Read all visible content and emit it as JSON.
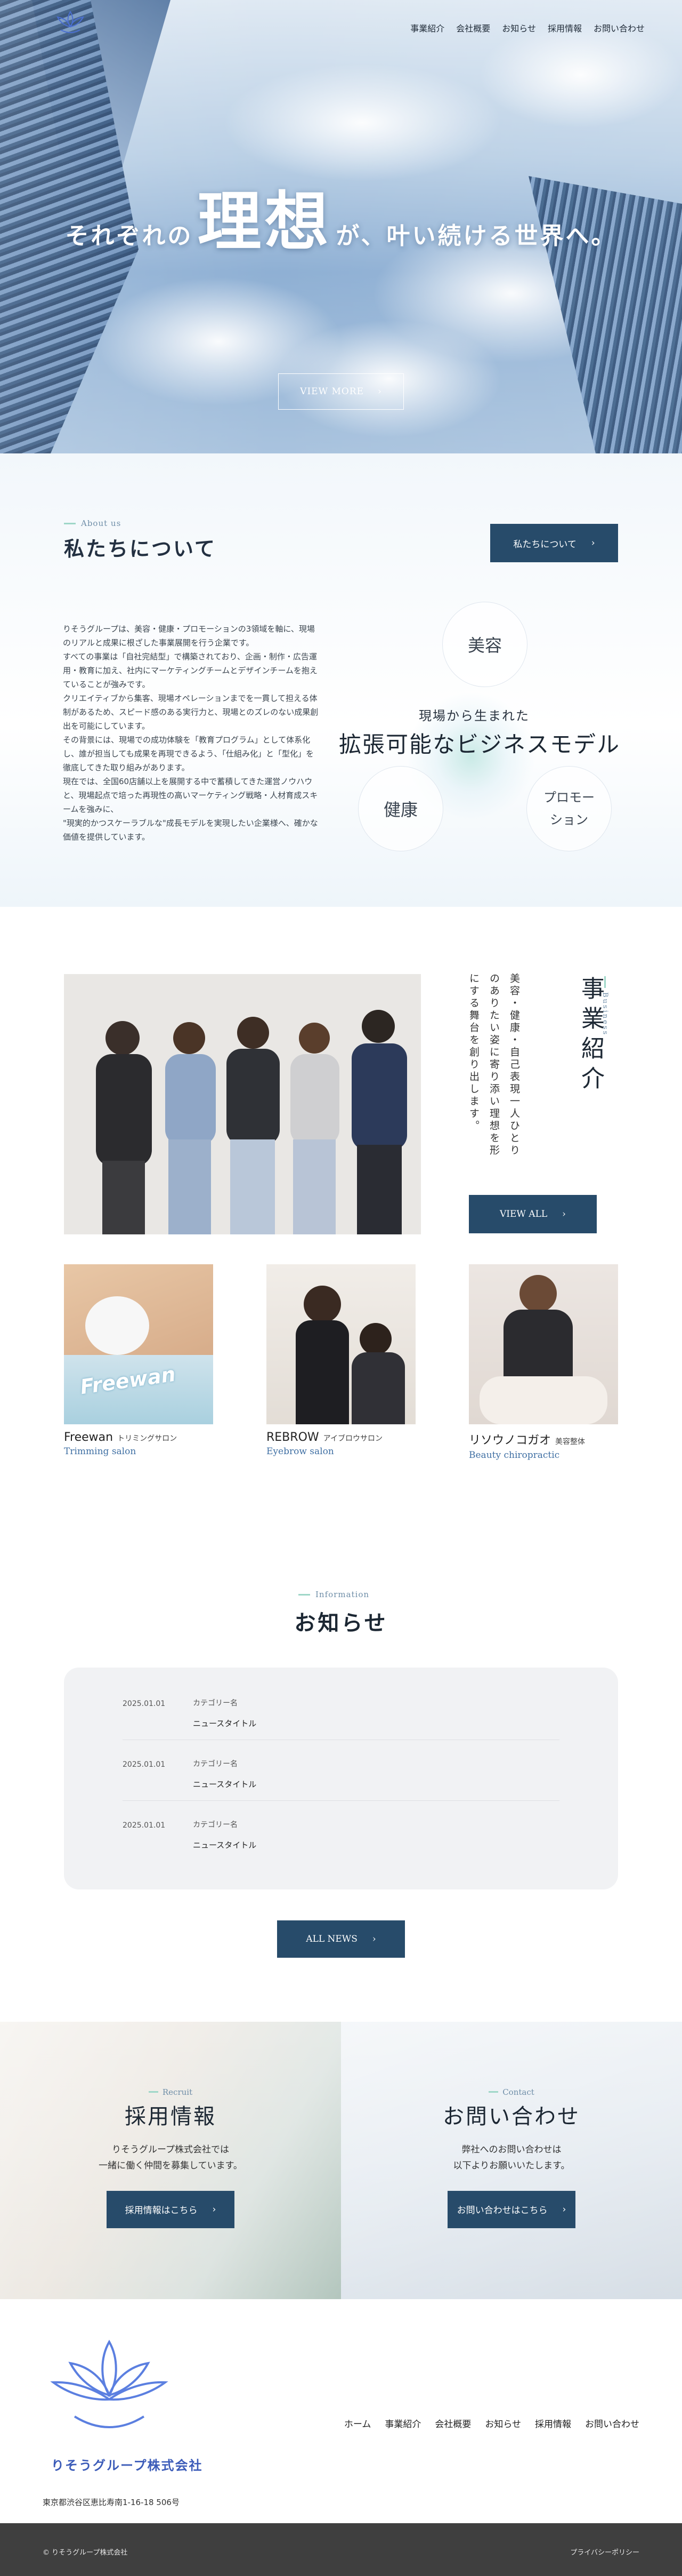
{
  "nav": {
    "items": [
      "事業紹介",
      "会社概要",
      "お知らせ",
      "採用情報",
      "お問い合わせ"
    ]
  },
  "hero": {
    "pre": "それぞれの",
    "keyword": "理想",
    "post": "が、叶い続ける世界へ。",
    "button_label": "VIEW MORE",
    "button_icon": "chevron-right-icon"
  },
  "about": {
    "label": "About us",
    "title": "私たちについて",
    "button_label": "私たちについて",
    "paragraphs": [
      "りそうグループは、美容・健康・プロモーションの3領域を軸に、現場のリアルと成果に根ざした事業展開を行う企業です。",
      "すべての事業は「自社完結型」で構築されており、企画・制作・広告運用・教育に加え、社内にマーケティングチームとデザインチームを抱えていることが強みです。",
      "クリエイティブから集客、現場オペレーションまでを一貫して担える体制があるため、スピード感のある実行力と、現場とのズレのない成果創出を可能にしています。",
      "その背景には、現場での成功体験を「教育プログラム」として体系化し、誰が担当しても成果を再現できるよう、「仕組み化」と「型化」を徹底してきた取り組みがあります。",
      "現在では、全国60店舗以上を展開する中で蓄積してきた運営ノウハウと、現場起点で培った再現性の高いマーケティング戦略・人材育成スキームを強みに、",
      "\"現実的かつスケーラブルな\"成長モデルを実現したい企業様へ、確かな価値を提供しています。"
    ],
    "model": {
      "beauty": "美容",
      "health": "健康",
      "promotion": "プロモーション",
      "subtitle": "現場から生まれた",
      "title": "拡張可能なビジネスモデル"
    }
  },
  "business": {
    "label": "Business",
    "title": "事業紹介",
    "text": "美容・健康・自己表現一人ひとりのありたい姿に寄り添い理想を形にする舞台を創り出します。",
    "button_label": "VIEW ALL",
    "salons": [
      {
        "name": "Freewan",
        "kana": "トリミングサロン",
        "en": "Trimming salon",
        "photo_text": "Freewan"
      },
      {
        "name": "REBROW",
        "kana": "アイブロウサロン",
        "en": "Eyebrow salon"
      },
      {
        "name": "リソウノコガオ",
        "kana": "美容整体",
        "en": "Beauty chiropractic"
      }
    ]
  },
  "news": {
    "label": "Information",
    "title": "お知らせ",
    "items": [
      {
        "date": "2025.01.01",
        "category": "カテゴリー名",
        "title": "ニュースタイトル"
      },
      {
        "date": "2025.01.01",
        "category": "カテゴリー名",
        "title": "ニュースタイトル"
      },
      {
        "date": "2025.01.01",
        "category": "カテゴリー名",
        "title": "ニュースタイトル"
      }
    ],
    "button_label": "ALL NEWS"
  },
  "recruit": {
    "label": "Recruit",
    "title": "採用情報",
    "text_line1": "りそうグループ株式会社では",
    "text_line2": "一緒に働く仲間を募集しています。",
    "button_label": "採用情報はこちら"
  },
  "contact": {
    "label": "Contact",
    "title": "お問い合わせ",
    "text_line1": "弊社へのお問い合わせは",
    "text_line2": "以下よりお願いいたします。",
    "button_label": "お問い合わせはこちら"
  },
  "footer": {
    "company": "りそうグループ株式会社",
    "address": "東京都渋谷区恵比寿南1-16-18 506号",
    "nav": [
      "ホーム",
      "事業紹介",
      "会社概要",
      "お知らせ",
      "採用情報",
      "お問い合わせ"
    ],
    "copyright": "© りそうグループ株式会社",
    "privacy": "プライバシーポリシー"
  },
  "colors": {
    "primary_button": "#274b6a",
    "accent_dash": "#9fd7c8",
    "label_blue": "#6f8ea8",
    "logo_blue": "#3b5bb8",
    "footer_bar": "#3f3f3f"
  }
}
